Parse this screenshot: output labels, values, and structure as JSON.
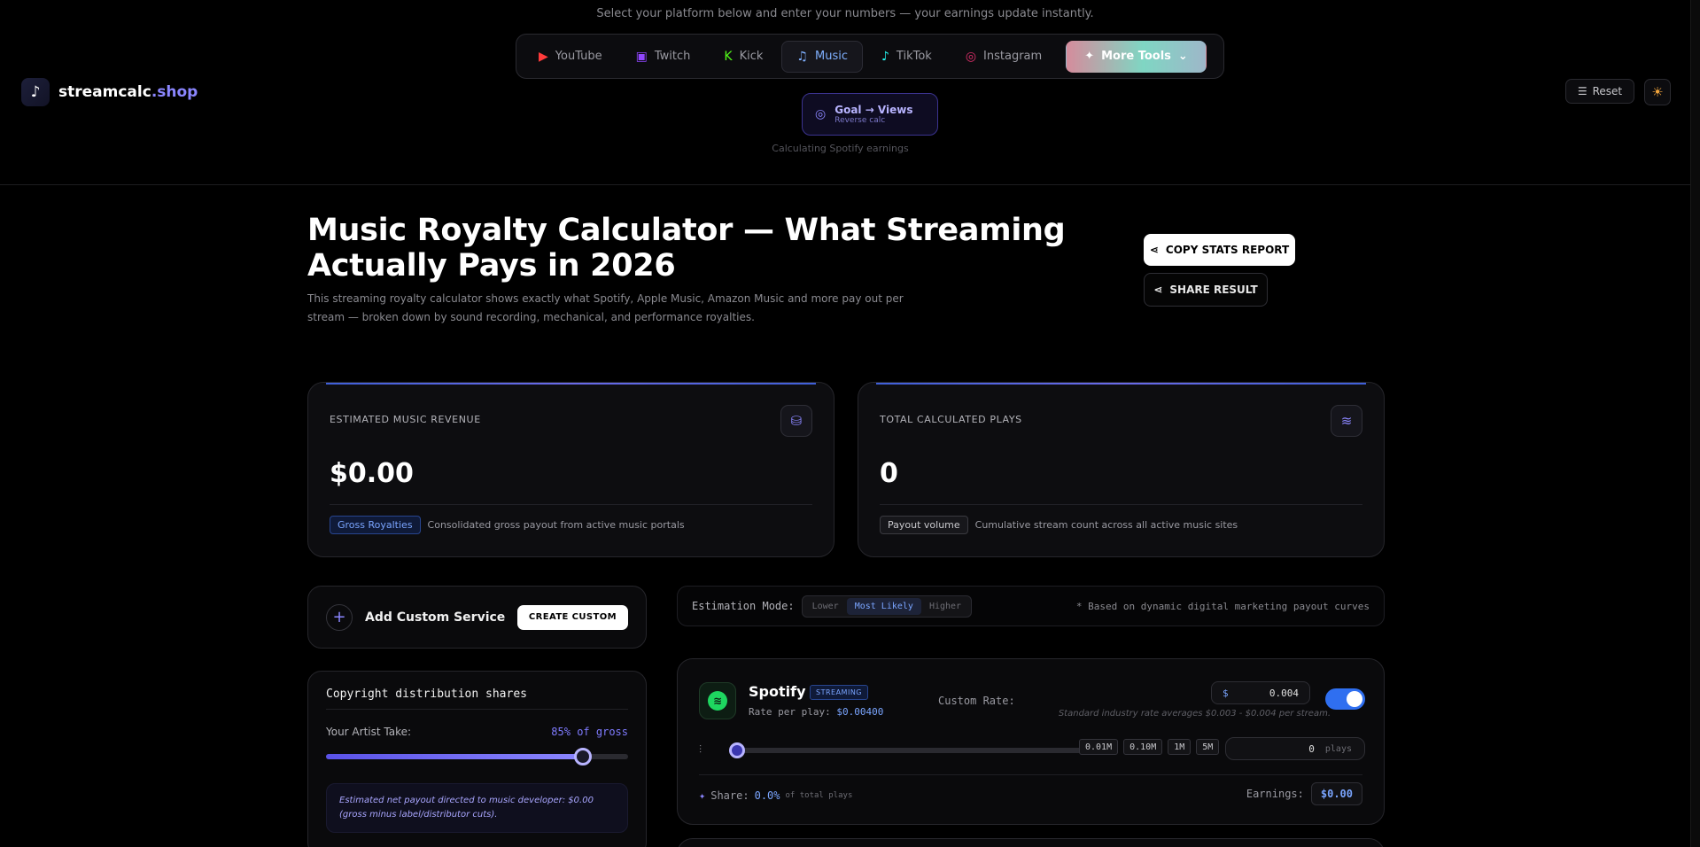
{
  "header": {
    "tagline": "Select your platform below and enter your numbers — your earnings update instantly.",
    "logo": {
      "name": "streamcalc",
      "tld": ".shop"
    },
    "platforms": [
      {
        "label": "YouTube",
        "icon": "youtube-icon",
        "glyph": "▶",
        "color": "#ff3b3b"
      },
      {
        "label": "Twitch",
        "icon": "twitch-icon",
        "glyph": "▣",
        "color": "#9146ff"
      },
      {
        "label": "Kick",
        "icon": "kick-icon",
        "glyph": "K",
        "color": "#53fc18"
      },
      {
        "label": "Music",
        "icon": "music-icon",
        "glyph": "♫",
        "color": "#7fb0ff",
        "active": true
      },
      {
        "label": "TikTok",
        "icon": "tiktok-icon",
        "glyph": "♪",
        "color": "#25f4ee"
      },
      {
        "label": "Instagram",
        "icon": "instagram-icon",
        "glyph": "◎",
        "color": "#e1306c"
      }
    ],
    "more_tools": "More Tools",
    "reverse": {
      "title": "Goal → Views",
      "subtitle": "Reverse calc"
    },
    "calculating_note": "Calculating Spotify earnings",
    "reset_label": "Reset"
  },
  "hero": {
    "title": "Music Royalty Calculator — What Streaming Actually Pays in 2026",
    "description": "This streaming royalty calculator shows exactly what Spotify, Apple Music, Amazon Music and more pay out per stream — broken down by sound recording, mechanical, and performance royalties.",
    "copy_button": "COPY STATS REPORT",
    "share_button": "SHARE RESULT"
  },
  "stats": [
    {
      "label": "ESTIMATED MUSIC REVENUE",
      "value": "$0.00",
      "badge": "Gross Royalties",
      "badge_style": "blue",
      "foot": "Consolidated gross payout from active music portals",
      "icon": "coins-icon",
      "glyph": "⛁"
    },
    {
      "label": "TOTAL CALCULATED PLAYS",
      "value": "0",
      "badge": "Payout volume",
      "badge_style": "grey",
      "foot": "Cumulative stream count across all active music sites",
      "icon": "layers-icon",
      "glyph": "≋"
    }
  ],
  "custom_service": {
    "title": "Add Custom Service",
    "button": "CREATE CUSTOM"
  },
  "distribution": {
    "heading": "Copyright distribution shares",
    "artist_take_label": "Your Artist Take:",
    "artist_take_value": "85% of gross",
    "artist_take_fraction": 0.85,
    "note": "Estimated net payout directed to music developer: $0.00 (gross minus label/distributor cuts)."
  },
  "estimation": {
    "label": "Estimation Mode:",
    "modes": [
      "Lower",
      "Most Likely",
      "Higher"
    ],
    "selected": "Most Likely",
    "note": "* Based on dynamic digital marketing payout curves"
  },
  "service": {
    "name": "Spotify",
    "category": "STREAMING",
    "rate_label": "Rate per play:",
    "rate_value": "$0.00400",
    "custom_rate_label": "Custom Rate:",
    "currency": "$",
    "custom_rate_value": "0.004",
    "custom_rate_note": "Standard industry rate averages $0.003 - $0.004 per stream.",
    "enabled": true,
    "plays_fraction": 0,
    "presets": [
      "0.01M",
      "0.10M",
      "1M",
      "5M"
    ],
    "plays_value": "0",
    "plays_unit": "plays",
    "share_label": "Share:",
    "share_value": "0.0%",
    "share_suffix": "of total plays",
    "earnings_label": "Earnings:",
    "earnings_value": "$0.00"
  }
}
